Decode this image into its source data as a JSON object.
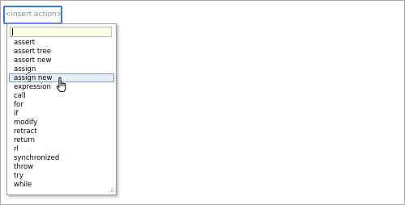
{
  "insert_action": {
    "label": "<insert action>"
  },
  "popup": {
    "filter_value": "",
    "items": [
      "assert",
      "assert tree",
      "assert new",
      "assign",
      "assign new",
      "expression",
      "call",
      "for",
      "if",
      "modify",
      "retract",
      "return",
      "rl",
      "synchronized",
      "throw",
      "try",
      "while"
    ],
    "selected_index": 4
  },
  "colors": {
    "focus_border": "#3c78d8",
    "input_background": "#ffffe6",
    "selection_background": "#e8eef8",
    "selection_border": "#7f9db9"
  },
  "icons": {
    "cursor": "hand-pointer-cursor-icon",
    "grip": "resize-grip-icon"
  }
}
